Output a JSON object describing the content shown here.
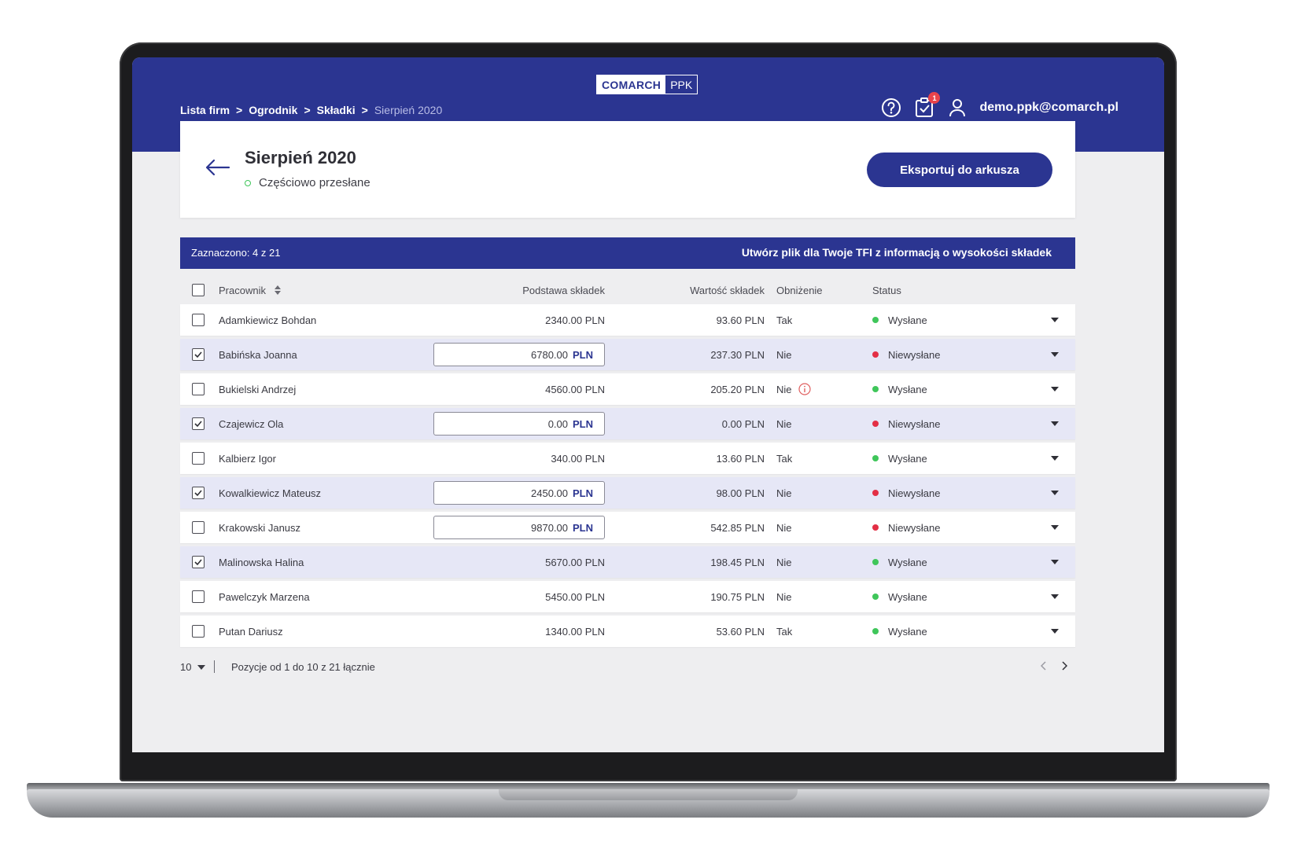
{
  "app": {
    "logo_main": "COMARCH",
    "logo_sub": "PPK"
  },
  "breadcrumb": [
    "Lista firm",
    "Ogrodnik",
    "Składki",
    "Sierpień 2020"
  ],
  "breadcrumb_separator": ">",
  "header": {
    "user_email": "demo.ppk@comarch.pl",
    "notification_count": "1",
    "icons": [
      "help-icon",
      "tasks-icon",
      "user-icon"
    ]
  },
  "page": {
    "title": "Sierpień 2020",
    "status": "Częściowo przesłane",
    "export_label": "Eksportuj do arkusza"
  },
  "selection": {
    "count_label": "Zaznaczono: 4 z 21",
    "create_file_label": "Utwórz plik dla Twoje TFI z informacją o wysokości składek"
  },
  "table": {
    "headers": {
      "employee": "Pracownik",
      "base": "Podstawa składek",
      "value": "Wartość składek",
      "reduction": "Obniżenie",
      "status": "Status"
    },
    "rows": [
      {
        "name": "Adamkiewicz Bohdan",
        "base": "2340.00 PLN",
        "value": "93.60 PLN",
        "reduction": "Tak",
        "status": "Wysłane",
        "status_color": "green",
        "checked": false,
        "editable": false,
        "info": false
      },
      {
        "name": "Babińska Joanna",
        "base": "6780.00",
        "value": "237.30 PLN",
        "reduction": "Nie",
        "status": "Niewysłane",
        "status_color": "red",
        "checked": true,
        "editable": true,
        "info": false
      },
      {
        "name": "Bukielski Andrzej",
        "base": "4560.00 PLN",
        "value": "205.20 PLN",
        "reduction": "Nie",
        "status": "Wysłane",
        "status_color": "green",
        "checked": false,
        "editable": false,
        "info": true
      },
      {
        "name": "Czajewicz Ola",
        "base": "0.00",
        "value": "0.00 PLN",
        "reduction": "Nie",
        "status": "Niewysłane",
        "status_color": "red",
        "checked": true,
        "editable": true,
        "info": false
      },
      {
        "name": "Kalbierz Igor",
        "base": "340.00 PLN",
        "value": "13.60 PLN",
        "reduction": "Tak",
        "status": "Wysłane",
        "status_color": "green",
        "checked": false,
        "editable": false,
        "info": false
      },
      {
        "name": "Kowalkiewicz Mateusz",
        "base": "2450.00",
        "value": "98.00 PLN",
        "reduction": "Nie",
        "status": "Niewysłane",
        "status_color": "red",
        "checked": true,
        "editable": true,
        "info": false
      },
      {
        "name": "Krakowski Janusz",
        "base": "9870.00",
        "value": "542.85 PLN",
        "reduction": "Nie",
        "status": "Niewysłane",
        "status_color": "red",
        "checked": false,
        "editable": true,
        "info": false
      },
      {
        "name": "Malinowska Halina",
        "base": "5670.00 PLN",
        "value": "198.45 PLN",
        "reduction": "Nie",
        "status": "Wysłane",
        "status_color": "green",
        "checked": true,
        "editable": false,
        "info": false
      },
      {
        "name": "Pawelczyk Marzena",
        "base": "5450.00 PLN",
        "value": "190.75 PLN",
        "reduction": "Nie",
        "status": "Wysłane",
        "status_color": "green",
        "checked": false,
        "editable": false,
        "info": false
      },
      {
        "name": "Putan Dariusz",
        "base": "1340.00 PLN",
        "value": "53.60 PLN",
        "reduction": "Tak",
        "status": "Wysłane",
        "status_color": "green",
        "checked": false,
        "editable": false,
        "info": false
      }
    ],
    "currency": "PLN"
  },
  "pagination": {
    "page_size": "10",
    "range_label": "Pozycje od 1 do 10 z 21 łącznie"
  },
  "colors": {
    "brand": "#2b3591",
    "sent": "#3fc65a",
    "not_sent": "#e32f45",
    "selected_row": "#e6e7f6",
    "background": "#eeeef0"
  }
}
